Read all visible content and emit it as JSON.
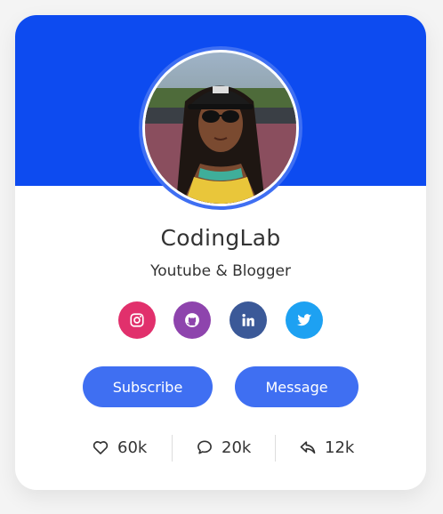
{
  "profile": {
    "name": "CodingLab",
    "job": "Youtube & Blogger"
  },
  "socials": [
    {
      "name": "instagram",
      "icon": "instagram-icon",
      "color": "#e1306c"
    },
    {
      "name": "github",
      "icon": "github-icon",
      "color": "#8e44ad"
    },
    {
      "name": "linkedin",
      "icon": "linkedin-icon",
      "color": "#3b5998"
    },
    {
      "name": "twitter",
      "icon": "twitter-icon",
      "color": "#1da1f2"
    }
  ],
  "buttons": {
    "subscribe": "Subscribe",
    "message": "Message"
  },
  "stats": {
    "likes": "60k",
    "comments": "20k",
    "shares": "12k"
  },
  "colors": {
    "banner": "#0d4bf0",
    "accent": "#3f6ff2",
    "text": "#333333"
  }
}
